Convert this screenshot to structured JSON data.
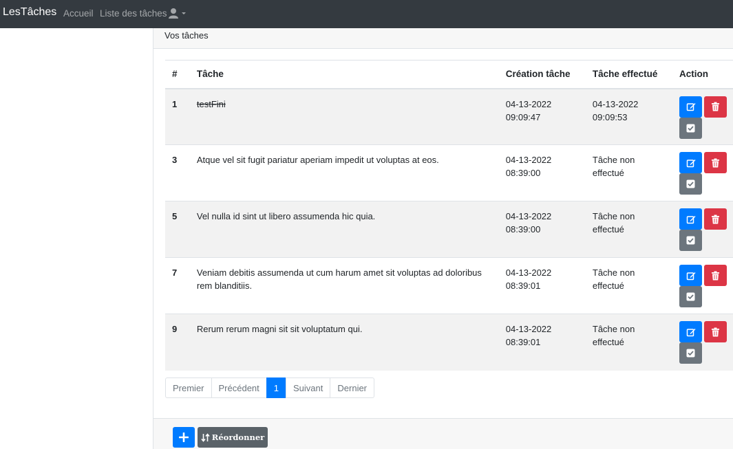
{
  "navbar": {
    "brand": "LesTâches",
    "links": [
      "Accueil",
      "Liste des tâches"
    ],
    "user_icon": "user-icon",
    "dropdown_icon": "caret-down-icon"
  },
  "card": {
    "header": "Vos tâches"
  },
  "table": {
    "headers": [
      "#",
      "Tâche",
      "Création tâche",
      "Tâche effectué",
      "Action"
    ],
    "rows": [
      {
        "num": "1",
        "task": "testFini",
        "created_date": "04-13-2022",
        "created_time": "09:09:47",
        "done_date": "04-13-2022",
        "done_time": "09:09:53",
        "done_status": ""
      },
      {
        "num": "3",
        "task": "Atque vel sit fugit pariatur aperiam impedit ut voluptas at eos.",
        "created_date": "04-13-2022",
        "created_time": "08:39:00",
        "done_date": "",
        "done_time": "",
        "done_status": "Tâche non effectué"
      },
      {
        "num": "5",
        "task": "Vel nulla id sint ut libero assumenda hic quia.",
        "created_date": "04-13-2022",
        "created_time": "08:39:00",
        "done_date": "",
        "done_time": "",
        "done_status": "Tâche non effectué"
      },
      {
        "num": "7",
        "task": "Veniam debitis assumenda ut cum harum amet sit voluptas ad doloribus rem blanditiis.",
        "created_date": "04-13-2022",
        "created_time": "08:39:01",
        "done_date": "",
        "done_time": "",
        "done_status": "Tâche non effectué"
      },
      {
        "num": "9",
        "task": "Rerum rerum magni sit sit voluptatum qui.",
        "created_date": "04-13-2022",
        "created_time": "08:39:01",
        "done_date": "",
        "done_time": "",
        "done_status": "Tâche non effectué"
      }
    ]
  },
  "pagination": {
    "first": "Premier",
    "previous": "Précédent",
    "current": "1",
    "next": "Suivant",
    "last": "Dernier"
  },
  "footer": {
    "add_icon": "plus-icon",
    "reorder_label": "Réordonner",
    "reorder_icon": "sort-icon"
  },
  "colors": {
    "navbar": "#343a40",
    "primary": "#007bff",
    "danger": "#dc3545",
    "secondary": "#6c757d"
  }
}
